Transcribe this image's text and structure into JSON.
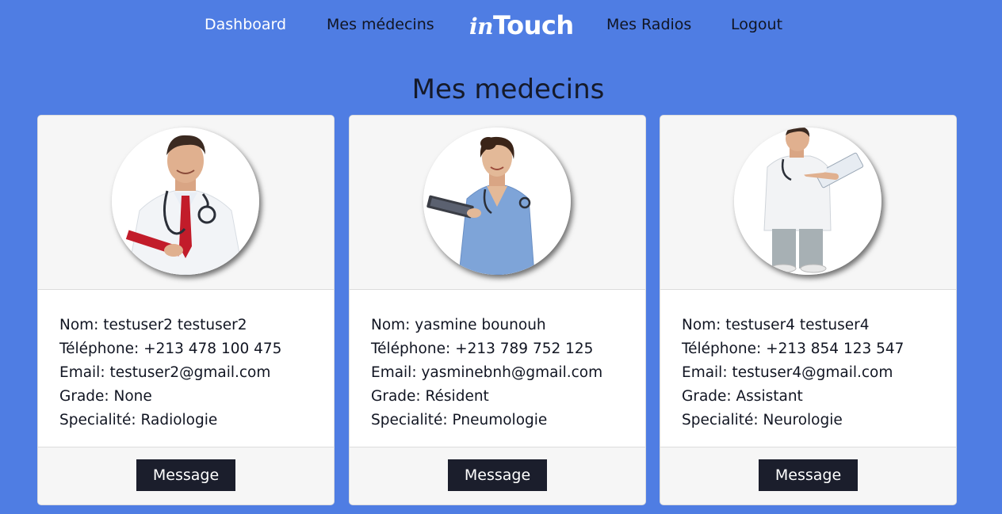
{
  "nav": {
    "dashboard": "Dashboard",
    "medecins": "Mes médecins",
    "brand_prefix": "in",
    "brand_suffix": "Touch",
    "radios": "Mes Radios",
    "logout": "Logout"
  },
  "page": {
    "title": "Mes medecins"
  },
  "doctors": [
    {
      "nom": "Nom: testuser2 testuser2",
      "telephone": "Téléphone: +213 478 100 475",
      "email": "Email: testuser2@gmail.com",
      "grade": "Grade: None",
      "specialite": "Specialité: Radiologie",
      "button": "Message",
      "photo_icon": "male-doctor-red-tie-photo"
    },
    {
      "nom": "Nom: yasmine bounouh",
      "telephone": "Téléphone: +213 789 752 125",
      "email": "Email: yasminebnh@gmail.com",
      "grade": "Grade: Résident",
      "specialite": "Specialité: Pneumologie",
      "button": "Message",
      "photo_icon": "female-nurse-scrubs-photo"
    },
    {
      "nom": "Nom: testuser4 testuser4",
      "telephone": "Téléphone: +213 854 123 547",
      "email": "Email: testuser4@gmail.com",
      "grade": "Grade: Assistant",
      "specialite": "Specialité: Neurologie",
      "button": "Message",
      "photo_icon": "male-doctor-clipboard-photo"
    }
  ],
  "colors": {
    "background": "#4f7de3",
    "button": "#1b1e2c",
    "card_header": "#f6f6f6"
  }
}
